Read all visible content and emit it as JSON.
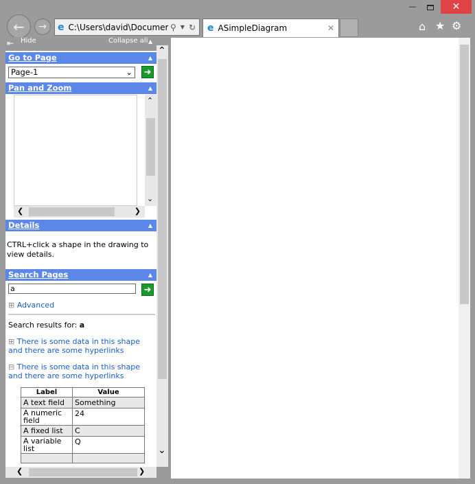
{
  "browser": {
    "address": "C:\\Users\\david\\Documer",
    "tab_title": "ASimpleDiagram"
  },
  "panel": {
    "hide_label": "Hide",
    "collapse_all_label": "Collapse all",
    "go_to_page": {
      "title": "Go to Page",
      "selected": "Page-1"
    },
    "pan_zoom": {
      "title": "Pan and Zoom"
    },
    "details": {
      "title": "Details",
      "text": "CTRL+click a shape in the drawing to view details."
    },
    "search": {
      "title": "Search Pages",
      "query": "a",
      "advanced": "Advanced",
      "results_label": "Search results for:",
      "results_query": "a",
      "results": [
        "There is some data in this shape and there are some hyperlinks",
        "There is some data in this shape and there are some hyperlinks"
      ],
      "table": {
        "headers": [
          "Label",
          "Value"
        ],
        "rows": [
          [
            "A text field",
            "Something"
          ],
          [
            "A numeric field",
            "24"
          ],
          [
            "A fixed list",
            "C"
          ],
          [
            "A variable list",
            "Q"
          ],
          [
            "",
            ""
          ]
        ]
      }
    }
  },
  "colors": {
    "section_header": "#5b87e8",
    "go_button": "#1a9a2a",
    "link": "#1a5ec8",
    "close_button": "#e04343"
  }
}
